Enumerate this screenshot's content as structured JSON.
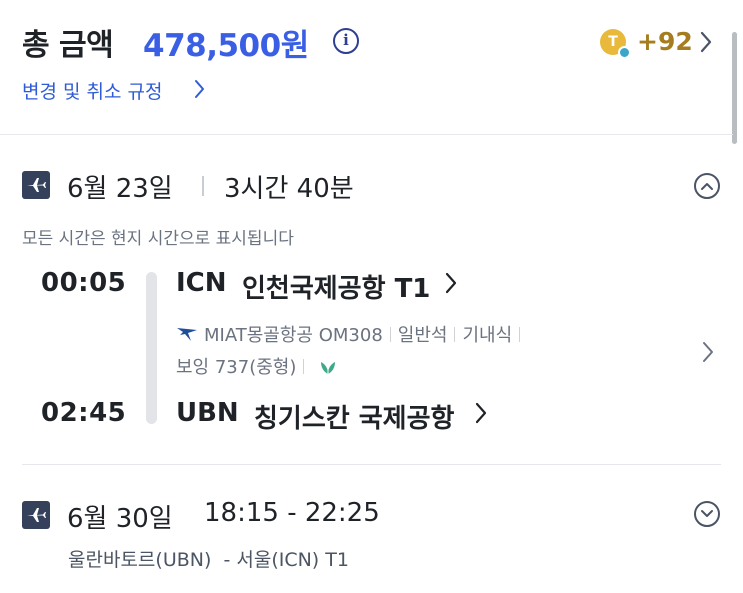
{
  "header": {
    "total_label": "총 금액",
    "total_amount": "478,500원",
    "info_glyph": "i",
    "coin_letter": "T",
    "points": "+92",
    "policy_link": "변경 및 취소 규정"
  },
  "segments": [
    {
      "date": "6월 23일",
      "duration": "3시간 40분",
      "note": "모든 시간은 현지 시간으로 표시됩니다",
      "departure": {
        "time": "00:05",
        "code": "ICN",
        "airport": "인천국제공항 T1"
      },
      "arrival": {
        "time": "02:45",
        "code": "UBN",
        "airport": "칭기스칸 국제공항"
      },
      "airline": "MIAT몽골항공",
      "flight_number": "OM308",
      "cabin": "일반석",
      "meal": "기내식",
      "aircraft": "보잉 737(중형)",
      "expanded": true
    },
    {
      "date": "6월 30일",
      "time_range": "18:15 - 22:25",
      "route": "울란바토르(UBN)  - 서울(ICN) T1",
      "expanded": false
    }
  ],
  "icons": {
    "info": "info-icon",
    "coin": "coin-icon",
    "chevron": "chevron-right-icon",
    "plane": "plane-icon",
    "collapse": "chevron-up-circle-icon",
    "expand": "chevron-down-circle-icon",
    "airline_logo": "miat-logo-icon",
    "eco": "leaf-icon"
  },
  "colors": {
    "accent": "#3a5fe5",
    "link": "#2f5bd6",
    "points": "#a57d1f",
    "coin": "#e8b93a",
    "plane_box": "#35405a",
    "eco": "#3fa98a"
  }
}
